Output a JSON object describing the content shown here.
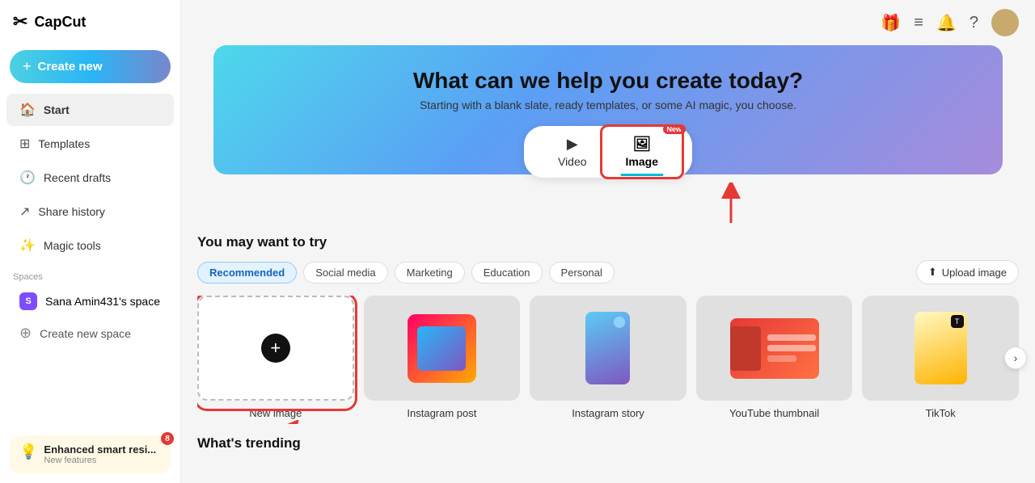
{
  "app": {
    "name": "CapCut",
    "logo_symbol": "✂"
  },
  "sidebar": {
    "create_new_label": "Create new",
    "nav_items": [
      {
        "id": "start",
        "label": "Start",
        "icon": "🏠",
        "active": true
      },
      {
        "id": "templates",
        "label": "Templates",
        "icon": "⊞"
      },
      {
        "id": "recent_drafts",
        "label": "Recent drafts",
        "icon": "🕐"
      },
      {
        "id": "share_history",
        "label": "Share history",
        "icon": "↗"
      },
      {
        "id": "magic_tools",
        "label": "Magic tools",
        "icon": "✨"
      }
    ],
    "spaces_label": "Spaces",
    "spaces": [
      {
        "id": "sana",
        "label": "Sana Amin431's space",
        "initial": "S"
      }
    ],
    "create_space_label": "Create new space",
    "notification": {
      "title": "Enhanced smart resi...",
      "subtitle": "New features",
      "badge": "8",
      "icon": "💡"
    }
  },
  "topbar": {
    "icons": [
      "🎁",
      "≡",
      "🔔",
      "?"
    ],
    "avatar_label": "User avatar"
  },
  "hero": {
    "title": "What can we help you create today?",
    "subtitle": "Starting with a blank slate, ready templates, or some AI magic, you choose.",
    "tabs": [
      {
        "id": "video",
        "label": "Video",
        "icon": "▶",
        "active": false
      },
      {
        "id": "image",
        "label": "Image",
        "icon": "🖼",
        "active": true,
        "badge": "New"
      }
    ]
  },
  "section_title": "You may want to try",
  "filters": [
    {
      "id": "recommended",
      "label": "Recommended",
      "active": true
    },
    {
      "id": "social_media",
      "label": "Social media",
      "active": false
    },
    {
      "id": "marketing",
      "label": "Marketing",
      "active": false
    },
    {
      "id": "education",
      "label": "Education",
      "active": false
    },
    {
      "id": "personal",
      "label": "Personal",
      "active": false
    }
  ],
  "upload_btn_label": "Upload image",
  "templates": [
    {
      "id": "new_image",
      "label": "New image",
      "type": "new"
    },
    {
      "id": "instagram_post",
      "label": "Instagram post",
      "type": "insta"
    },
    {
      "id": "instagram_story",
      "label": "Instagram story",
      "type": "story"
    },
    {
      "id": "youtube_thumbnail",
      "label": "YouTube thumbnail",
      "type": "yt"
    },
    {
      "id": "tiktok",
      "label": "TikTok",
      "type": "tiktok"
    }
  ],
  "trending_title": "What's trending"
}
